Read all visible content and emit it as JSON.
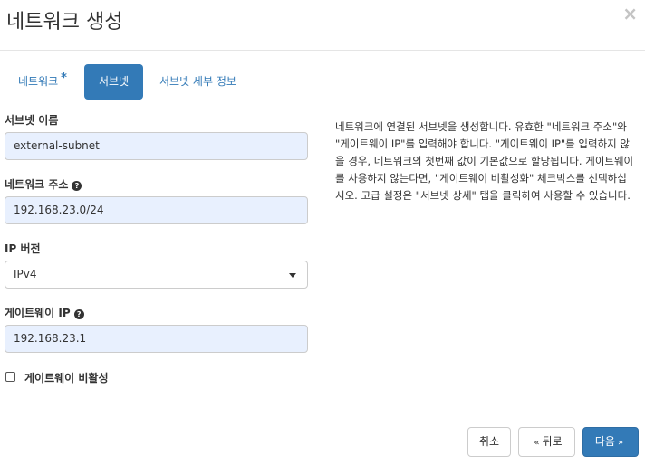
{
  "dialog": {
    "title": "네트워크 생성",
    "close_glyph": "×"
  },
  "tabs": [
    {
      "label": "네트워크",
      "required_mark": "*",
      "active": false
    },
    {
      "label": "서브넷",
      "active": true
    },
    {
      "label": "서브넷 세부 정보",
      "active": false
    }
  ],
  "form": {
    "subnet_name_label": "서브넷 이름",
    "subnet_name_value": "external-subnet",
    "network_address_label": "네트워크 주소",
    "network_address_value": "192.168.23.0/24",
    "ip_version_label": "IP 버전",
    "ip_version_value": "IPv4",
    "gateway_ip_label": "게이트웨이 IP",
    "gateway_ip_value": "192.168.23.1",
    "disable_gateway_label": "게이트웨이 비활성",
    "disable_gateway_checked": false,
    "help_glyph": "?"
  },
  "help": {
    "text": "네트워크에 연결된 서브넷을 생성합니다. 유효한 \"네트워크 주소\"와 \"게이트웨이 IP\"를 입력해야 합니다. \"게이트웨이 IP\"를 입력하지 않을 경우, 네트워크의 첫번째 값이 기본값으로 할당됩니다. 게이트웨이를 사용하지 않는다면, \"게이트웨이 비활성화\" 체크박스를 선택하십시오. 고급 설정은 \"서브넷 상세\" 탭을 클릭하여 사용할 수 있습니다."
  },
  "footer": {
    "cancel_label": "취소",
    "back_label": "뒤로",
    "back_arrow": "«",
    "next_label": "다음",
    "next_arrow": "»"
  },
  "colors": {
    "accent": "#337ab7",
    "autofill_bg": "#e8f0fe"
  }
}
